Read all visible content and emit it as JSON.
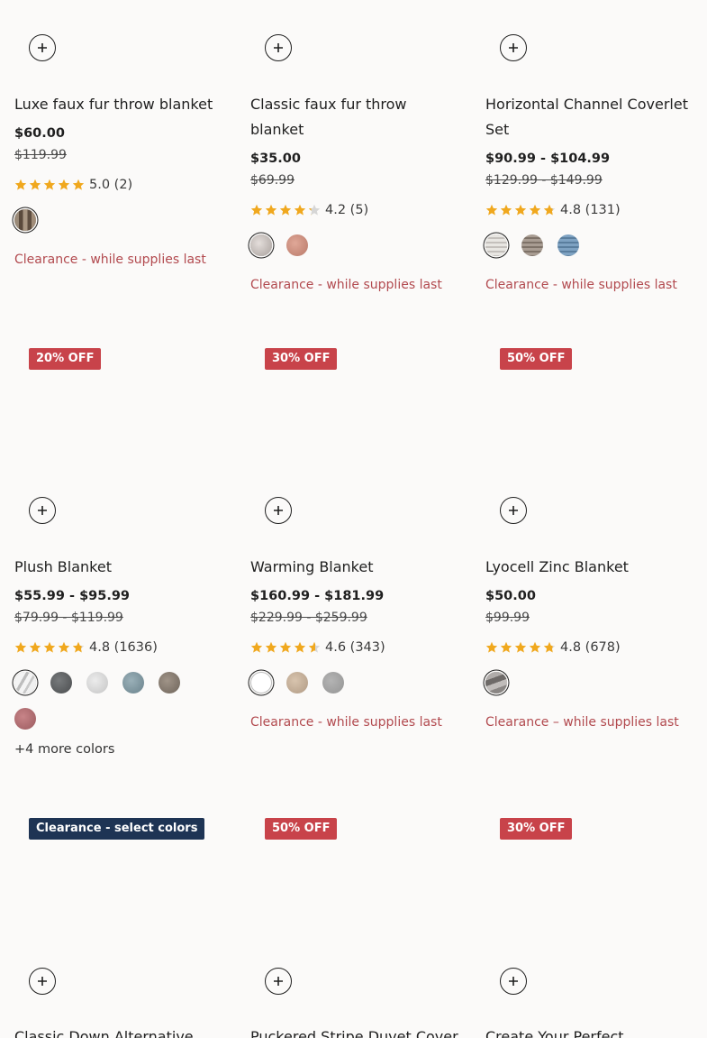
{
  "products": [
    {
      "title": "Luxe faux fur throw blanket",
      "price": "$60.00",
      "was": "$119.99",
      "rating": "5.0 (2)",
      "stars": 5.0,
      "swatches": [
        "linear-gradient(90deg,#9a8a78 0 20%,#5a4a3c 20% 40%,#a89682 40% 60%,#5e4e40 60% 80%,#a08c78 80%)"
      ],
      "clearance": "Clearance - while supplies last"
    },
    {
      "title": "Classic faux fur throw blanket",
      "price": "$35.00",
      "was": "$69.99",
      "rating": "4.2 (5)",
      "stars": 4.2,
      "swatches": [
        "radial-gradient(circle at 40% 40%,#e4dedb,#a8a09c)",
        "radial-gradient(circle at 40% 40%,#e0a898,#b87868)"
      ],
      "clearance": "Clearance - while supplies last"
    },
    {
      "title": "Horizontal Channel Coverlet Set",
      "price": "$90.99 - $104.99",
      "was": "$129.99 - $149.99",
      "rating": "4.8 (131)",
      "stars": 4.8,
      "swatches": [
        "repeating-linear-gradient(180deg,#e8e6e2 0 3px,#c4c0bc 3px 5px)",
        "repeating-linear-gradient(180deg,#a89c92 0 3px,#7e7268 3px 5px)",
        "repeating-linear-gradient(180deg,#7ea2c2 0 3px,#5a7e9e 3px 5px)"
      ],
      "clearance": "Clearance - while supplies last"
    },
    {
      "badge": "20% OFF",
      "title": "Plush Blanket",
      "price": "$55.99 - $95.99",
      "was": "$79.99 - $119.99",
      "rating": "4.8 (1636)",
      "stars": 4.8,
      "swatches": [
        "linear-gradient(120deg,#f4f4f4 0 35%,#bdbdbd 35% 45%,#f4f4f4 45% 60%,#c8c8c8 60% 68%,#f0f0f0 68%)",
        "radial-gradient(circle at 40% 40%,#777a7c,#4a4c4e)",
        "radial-gradient(circle at 40% 40%,#ececec,#c4c4c4)",
        "radial-gradient(circle at 40% 40%,#9ab0b8,#6a828c)",
        "radial-gradient(circle at 40% 40%,#a09488,#6e645a)",
        "radial-gradient(circle at 40% 40%,#c88488,#9a5a5e)"
      ],
      "more": "+4 more colors"
    },
    {
      "badge": "30% OFF",
      "title": "Warming Blanket",
      "price": "$160.99 - $181.99",
      "was": "$229.99 - $259.99",
      "rating": "4.6 (343)",
      "stars": 4.6,
      "swatches": [
        "#ffffff",
        "radial-gradient(circle at 40% 40%,#d8c4ae,#b09a84)",
        "radial-gradient(circle at 40% 40%,#b4b4b4,#949494)"
      ],
      "clearance": "Clearance - while supplies last"
    },
    {
      "badge": "50% OFF",
      "title": "Lyocell Zinc Blanket",
      "price": "$50.00",
      "was": "$99.99",
      "rating": "4.8 (678)",
      "stars": 4.8,
      "swatches": [
        "linear-gradient(160deg,#b0acaa 0 30%,#6e6a68 30% 50%,#c0bcba 50% 70%,#8a8684 70%)"
      ],
      "clearance": "Clearance – while supplies last"
    },
    {
      "badge": "Clearance - select colors",
      "badge_style": "navy",
      "title": "Classic Down Alternative"
    },
    {
      "badge": "50% OFF",
      "title": "Puckered Stripe Duvet Cover"
    },
    {
      "badge": "30% OFF",
      "title": "Create Your Perfect"
    }
  ],
  "colors": {
    "star": "#f0a81e",
    "star_empty": "#d6d6d6",
    "badge_red": "#c8434a",
    "badge_navy": "#1e3454",
    "clearance_text": "#b24a4f"
  },
  "icons": {
    "add": "plus-icon",
    "star": "star-icon"
  }
}
